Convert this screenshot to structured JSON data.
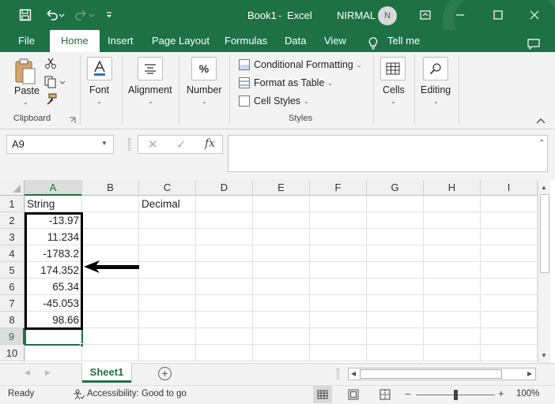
{
  "window": {
    "doc_title": "Book1",
    "separator": "-",
    "app_name": "Excel",
    "user_name": "NIRMAL",
    "user_initial": "N"
  },
  "menu": {
    "tabs": [
      "File",
      "Home",
      "Insert",
      "Page Layout",
      "Formulas",
      "Data",
      "View"
    ],
    "active_tab": "Home",
    "tell_me": "Tell me"
  },
  "ribbon": {
    "clipboard": {
      "paste_label": "Paste",
      "group_label": "Clipboard"
    },
    "font_label": "Font",
    "alignment_label": "Alignment",
    "number_label": "Number",
    "number_glyph": "%",
    "styles": {
      "conditional_formatting": "Conditional Formatting",
      "format_as_table": "Format as Table",
      "cell_styles": "Cell Styles",
      "group_label": "Styles"
    },
    "cells_label": "Cells",
    "editing_label": "Editing"
  },
  "formula_bar": {
    "name_box": "A9",
    "fx_label": "fx",
    "value": ""
  },
  "sheet": {
    "columns": [
      "A",
      "B",
      "C",
      "D",
      "E",
      "F",
      "G",
      "H",
      "I"
    ],
    "rows": [
      "1",
      "2",
      "3",
      "4",
      "5",
      "6",
      "7",
      "8",
      "9",
      "10"
    ],
    "selected_cell": "A9",
    "a1": "String",
    "c1": "Decimal",
    "column_a_values": [
      "-13.97",
      "11.234",
      "-1783.2",
      "174.352",
      "65.34",
      "-45.053",
      "98.66"
    ]
  },
  "tabs": {
    "sheet_name": "Sheet1",
    "add_sheet": "+"
  },
  "status": {
    "ready": "Ready",
    "accessibility": "Accessibility: Good to go",
    "zoom": "100%"
  },
  "colors": {
    "accent": "#1e7145",
    "annotation": "#000000"
  }
}
